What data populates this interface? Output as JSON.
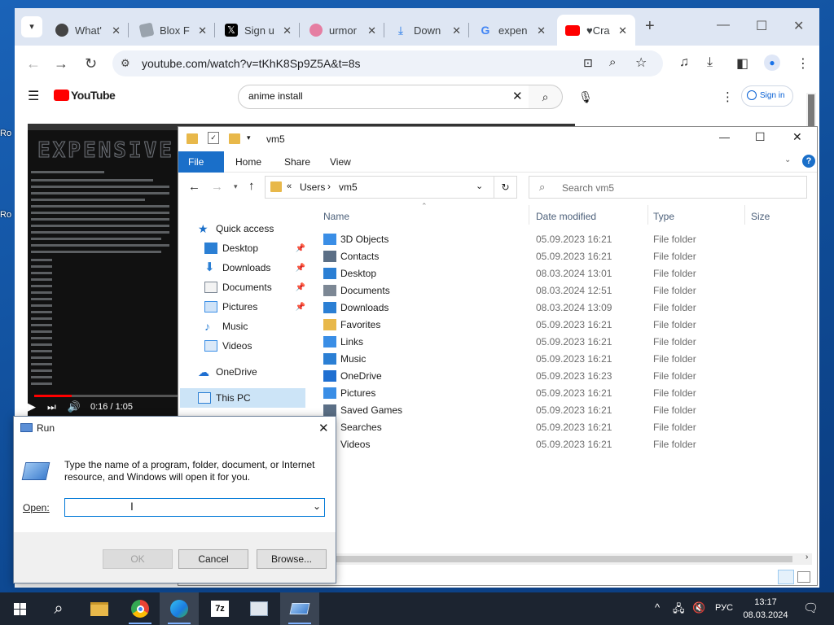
{
  "desktop": {
    "labels": [
      "Ro",
      "Ro"
    ]
  },
  "chrome": {
    "tabs": [
      {
        "title": "What'",
        "icon": "github-icon"
      },
      {
        "title": "Blox F",
        "icon": "blox-icon"
      },
      {
        "title": "Sign u",
        "icon": "x-icon"
      },
      {
        "title": "urmor",
        "icon": "app-icon"
      },
      {
        "title": "Down",
        "icon": "download-icon"
      },
      {
        "title": "expen",
        "icon": "google-icon"
      },
      {
        "title": "♥Cra",
        "icon": "youtube-icon",
        "active": true
      }
    ],
    "new_tab": "+",
    "url": "youtube.com/watch?v=tKhK8Sp9Z5A&t=8s"
  },
  "youtube": {
    "logo": "YouTube",
    "search_value": "anime install",
    "sign_in": "Sign in",
    "video_title_art": "EXPENSIVE",
    "time": "0:16 / 1:05"
  },
  "explorer": {
    "title": "vm5",
    "ribbon": [
      "File",
      "Home",
      "Share",
      "View"
    ],
    "breadcrumb": [
      "«",
      "Users",
      "›",
      "vm5"
    ],
    "search_placeholder": "Search vm5",
    "nav": {
      "quick_access": "Quick access",
      "items": [
        "Desktop",
        "Downloads",
        "Documents",
        "Pictures",
        "Music",
        "Videos"
      ],
      "onedrive": "OneDrive",
      "this_pc": "This PC"
    },
    "columns": [
      "Name",
      "Date modified",
      "Type",
      "Size"
    ],
    "rows": [
      {
        "name": "3D Objects",
        "date": "05.09.2023 16:21",
        "type": "File folder",
        "color": "#3a8ee6"
      },
      {
        "name": "Contacts",
        "date": "05.09.2023 16:21",
        "type": "File folder",
        "color": "#5b6f86"
      },
      {
        "name": "Desktop",
        "date": "08.03.2024 13:01",
        "type": "File folder",
        "color": "#2b7fd4"
      },
      {
        "name": "Documents",
        "date": "08.03.2024 12:51",
        "type": "File folder",
        "color": "#7c8794"
      },
      {
        "name": "Downloads",
        "date": "08.03.2024 13:09",
        "type": "File folder",
        "color": "#2b7fd4"
      },
      {
        "name": "Favorites",
        "date": "05.09.2023 16:21",
        "type": "File folder",
        "color": "#e8b84a"
      },
      {
        "name": "Links",
        "date": "05.09.2023 16:21",
        "type": "File folder",
        "color": "#3a8ee6"
      },
      {
        "name": "Music",
        "date": "05.09.2023 16:21",
        "type": "File folder",
        "color": "#2b7fd4"
      },
      {
        "name": "OneDrive",
        "date": "05.09.2023 16:23",
        "type": "File folder",
        "color": "#1f6fd1"
      },
      {
        "name": "Pictures",
        "date": "05.09.2023 16:21",
        "type": "File folder",
        "color": "#3a8ee6"
      },
      {
        "name": "Saved Games",
        "date": "05.09.2023 16:21",
        "type": "File folder",
        "color": "#5b6f86"
      },
      {
        "name": "Searches",
        "date": "05.09.2023 16:21",
        "type": "File folder",
        "color": "#7c8794"
      },
      {
        "name": "Videos",
        "date": "05.09.2023 16:21",
        "type": "File folder",
        "color": "#3a8ee6"
      }
    ]
  },
  "run": {
    "title": "Run",
    "message": "Type the name of a program, folder, document, or Internet resource, and Windows will open it for you.",
    "open_label": "Open:",
    "open_value": "",
    "ok": "OK",
    "cancel": "Cancel",
    "browse": "Browse..."
  },
  "taskbar": {
    "lang": "РУС",
    "time": "13:17",
    "date": "08.03.2024"
  }
}
